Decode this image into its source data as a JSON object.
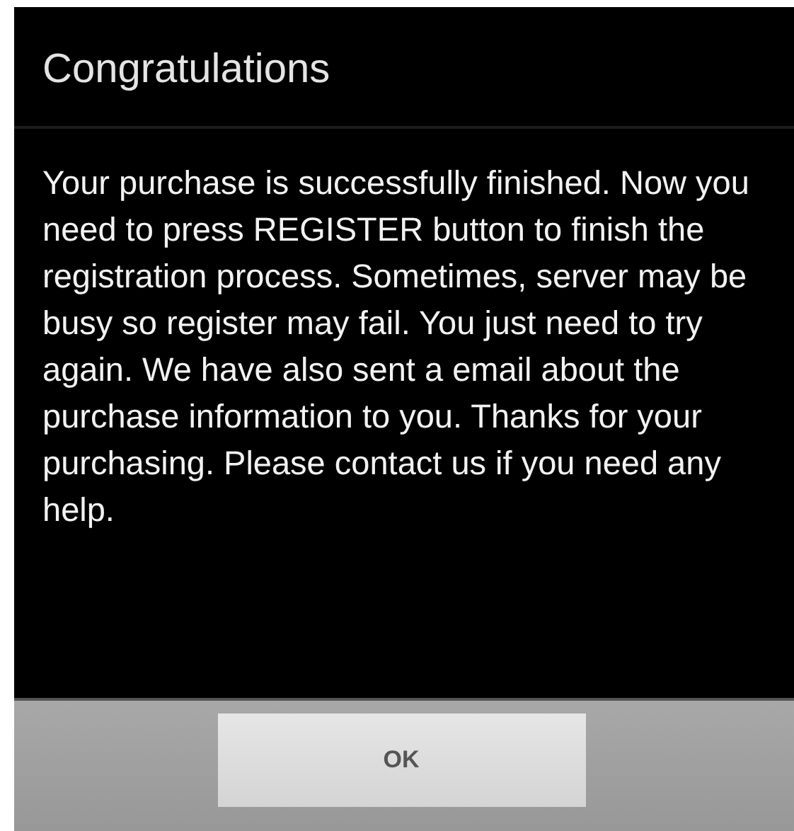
{
  "dialog": {
    "title": "Congratulations",
    "message": "Your purchase is successfully finished. Now you need to press REGISTER button to finish the registration process. Sometimes, server may be busy so register may fail. You just need to try again. We have also sent a email about the purchase information to you. Thanks for your purchasing. Please contact us if you need any help.",
    "buttons": [
      "OK"
    ]
  }
}
